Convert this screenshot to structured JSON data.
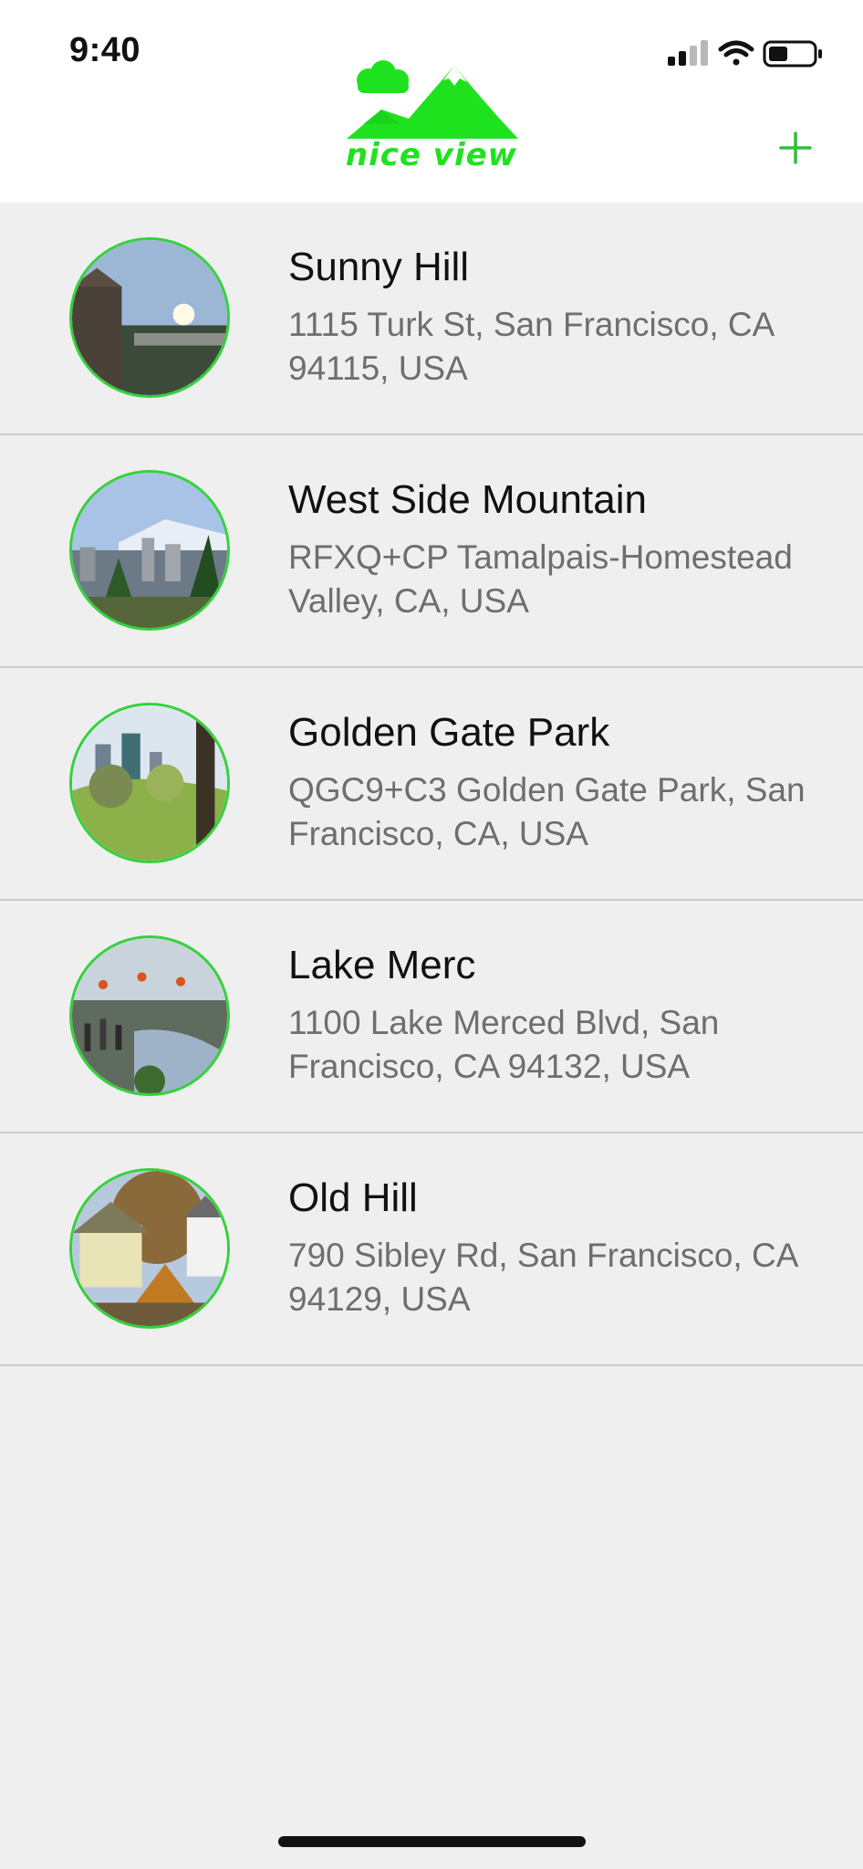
{
  "status_bar": {
    "time": "9:40",
    "icons": [
      "signal-icon",
      "wifi-icon",
      "battery-icon"
    ]
  },
  "header": {
    "logo_text": "nice view",
    "add_icon": "plus-icon"
  },
  "colors": {
    "brand_green": "#1fe21f",
    "ring_green": "#35d13c",
    "background": "#efefef"
  },
  "places": [
    {
      "title": "Sunny Hill",
      "address": "1115 Turk St, San Francisco, CA 94115, USA"
    },
    {
      "title": "West Side Mountain",
      "address": "RFXQ+CP Tamalpais-Homestead Valley, CA, USA"
    },
    {
      "title": "Golden Gate Park",
      "address": "QGC9+C3 Golden Gate Park, San Francisco, CA, USA"
    },
    {
      "title": "Lake Merc",
      "address": "1100 Lake Merced Blvd, San Francisco, CA 94132, USA"
    },
    {
      "title": "Old Hill",
      "address": "790 Sibley Rd, San Francisco, CA 94129, USA"
    }
  ]
}
